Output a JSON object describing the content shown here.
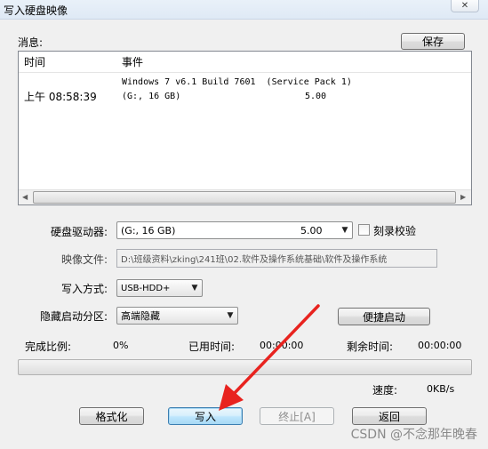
{
  "window": {
    "title": "写入硬盘映像",
    "close_glyph": "✕"
  },
  "messages": {
    "label": "消息:",
    "save_label": "保存",
    "columns": {
      "time": "时间",
      "event": "事件"
    },
    "rows": [
      {
        "time": "",
        "event": "Windows 7 v6.1 Build 7601  (Service Pack 1)"
      },
      {
        "time": "上午 08:58:39",
        "event": "(G:, 16 GB)",
        "extra": "5.00"
      }
    ]
  },
  "drive": {
    "label": "硬盘驱动器:",
    "value": "(G:, 16 GB)",
    "value_extra": "5.00",
    "verify_label": "刻录校验"
  },
  "image_file": {
    "label": "映像文件:",
    "value": "D:\\班级资料\\zking\\241班\\02.软件及操作系统基础\\软件及操作系统"
  },
  "write_method": {
    "label": "写入方式:",
    "value": "USB-HDD+"
  },
  "hidden_partition": {
    "label": "隐藏启动分区:",
    "value": "高端隐藏",
    "quick_boot_label": "便捷启动"
  },
  "progress": {
    "done_label": "完成比例:",
    "done_value": "0%",
    "elapsed_label": "已用时间:",
    "elapsed_value": "00:00:00",
    "remaining_label": "剩余时间:",
    "remaining_value": "00:00:00",
    "fraction": 0,
    "speed_label": "速度:",
    "speed_value": "0KB/s"
  },
  "buttons": {
    "format": "格式化",
    "write": "写入",
    "abort": "终止[A]",
    "back": "返回"
  },
  "watermark": "CSDN @不念那年晚春",
  "colors": {
    "annotation_arrow": "#e8231f",
    "focus_border": "#3c7fb1"
  },
  "icons": {
    "close": "close-icon",
    "dropdown": "chevron-down-icon",
    "scroll_left": "arrow-left-icon",
    "scroll_right": "arrow-right-icon"
  }
}
